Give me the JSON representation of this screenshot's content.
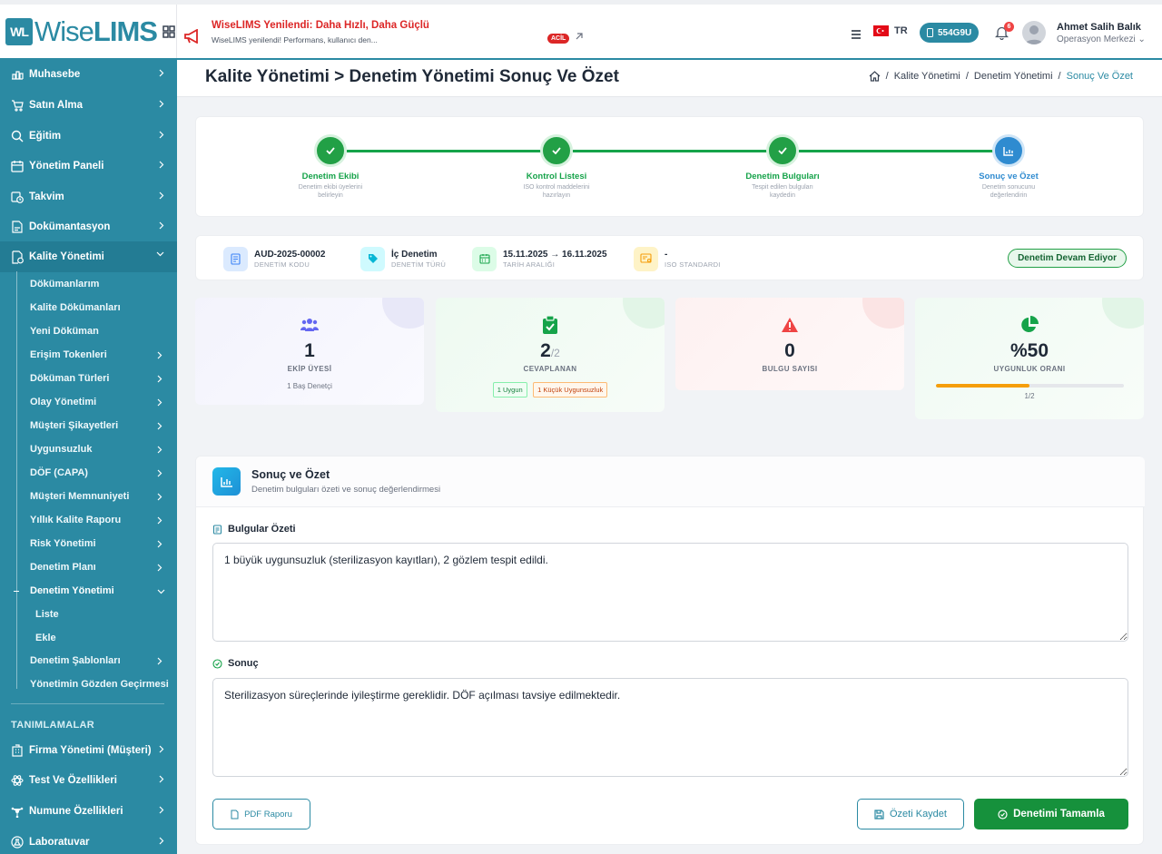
{
  "brand": {
    "logo_mark": "WL",
    "logo_name": "Wise",
    "logo_name_bold": "LIMS"
  },
  "announcement": {
    "title": "WiseLIMS Yenilendi: Daha Hızlı, Daha Güçlü",
    "subtitle": "WiseLIMS yenilendi! Performans, kullanıcı den...",
    "badge": "ACİL"
  },
  "topbar": {
    "language": "TR",
    "credit": "554G9U",
    "notification_count": "6",
    "user_name": "Ahmet Salih Balık",
    "user_role": "Operasyon Merkezi"
  },
  "sidebar": {
    "items": [
      {
        "label": "Muhasebe"
      },
      {
        "label": "Satın Alma"
      },
      {
        "label": "Eğitim"
      },
      {
        "label": "Yönetim Paneli"
      },
      {
        "label": "Takvim"
      },
      {
        "label": "Dokümantasyon"
      },
      {
        "label": "Kalite Yönetimi"
      }
    ],
    "sub_items": [
      {
        "label": "Dökümanlarım"
      },
      {
        "label": "Kalite Dökümanları"
      },
      {
        "label": "Yeni Döküman"
      },
      {
        "label": "Erişim Tokenleri"
      },
      {
        "label": "Döküman Türleri"
      },
      {
        "label": "Olay Yönetimi"
      },
      {
        "label": "Müşteri Şikayetleri"
      },
      {
        "label": "Uygunsuzluk"
      },
      {
        "label": "DÖF (CAPA)"
      },
      {
        "label": "Müşteri Memnuniyeti"
      },
      {
        "label": "Yıllık Kalite Raporu"
      },
      {
        "label": "Risk Yönetimi"
      },
      {
        "label": "Denetim Planı"
      },
      {
        "label": "Denetim Yönetimi"
      },
      {
        "label": "Liste"
      },
      {
        "label": "Ekle"
      },
      {
        "label": "Denetim Şablonları"
      },
      {
        "label": "Yönetimin Gözden Geçirmesi"
      }
    ],
    "section_title": "TANIMLAMALAR",
    "def_items": [
      {
        "label": "Firma Yönetimi (Müşteri)"
      },
      {
        "label": "Test Ve Özellikleri"
      },
      {
        "label": "Numune Özellikleri"
      },
      {
        "label": "Laboratuvar"
      }
    ]
  },
  "page": {
    "title": "Kalite Yönetimi > Denetim Yönetimi Sonuç Ve Özet",
    "breadcrumb": [
      "Kalite Yönetimi",
      "Denetim Yönetimi",
      "Sonuç Ve Özet"
    ]
  },
  "steps": [
    {
      "title": "Denetim Ekibi",
      "desc": "Denetim ekibi üyelerini belirleyin",
      "state": "done"
    },
    {
      "title": "Kontrol Listesi",
      "desc": "ISO kontrol maddelerini hazırlayın",
      "state": "done"
    },
    {
      "title": "Denetim Bulguları",
      "desc": "Tespit edilen bulguları kaydedin",
      "state": "done"
    },
    {
      "title": "Sonuç ve Özet",
      "desc": "Denetim sonucunu değerlendirin",
      "state": "current"
    }
  ],
  "audit_info": {
    "code": {
      "value": "AUD-2025-00002",
      "label": "DENETİM KODU"
    },
    "type": {
      "value": "İç Denetim",
      "label": "DENETİM TÜRÜ"
    },
    "dates": {
      "value": "15.11.2025 → 16.11.2025",
      "label": "TARİH ARALIĞI"
    },
    "standard": {
      "value": "-",
      "label": "ISO STANDARDI"
    },
    "status": "Denetim Devam Ediyor"
  },
  "stats": {
    "team": {
      "value": "1",
      "label": "EKİP ÜYESİ",
      "sub": "1 Baş Denetçi"
    },
    "answered": {
      "value": "2",
      "total": "/2",
      "label": "CEVAPLANAN",
      "tag_ok": "1 Uygun",
      "tag_minor": "1 Küçük Uygunsuzluk"
    },
    "findings": {
      "value": "0",
      "label": "BULGU SAYISI"
    },
    "compliance": {
      "value": "%50",
      "label": "UYGUNLUK ORANI",
      "progress_text": "1/2",
      "progress_fraction": 0.5
    }
  },
  "summary_panel": {
    "title": "Sonuç ve Özet",
    "subtitle": "Denetim bulguları özeti ve sonuç değerlendirmesi",
    "findings_label": "Bulgular Özeti",
    "findings_text": "1 büyük uygunsuzluk (sterilizasyon kayıtları), 2 gözlem tespit edildi.",
    "result_label": "Sonuç",
    "result_text": "Sterilizasyon süreçlerinde iyileştirme gereklidir. DÖF açılması tavsiye edilmektedir.",
    "pdf_button": "PDF Raporu",
    "save_button": "Özeti Kaydet",
    "complete_button": "Denetimi Tamamla"
  },
  "colors": {
    "primary": "#2b8aa3",
    "success": "#16913c",
    "danger": "#dc2626",
    "warning": "#f59e0b",
    "info": "#2f8bd0"
  }
}
